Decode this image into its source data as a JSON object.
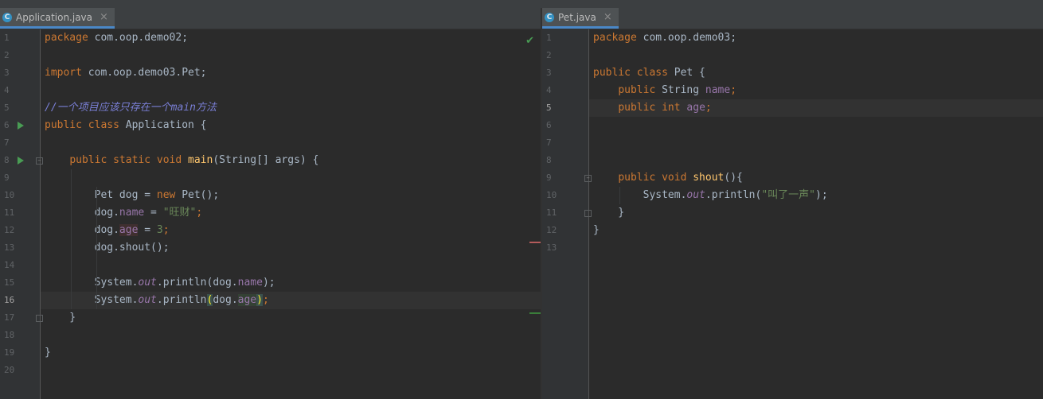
{
  "colors": {
    "keyword": "#cc7832",
    "string": "#6a8759",
    "field": "#9876aa",
    "method": "#ffc66d",
    "comment": "#7a7fd6",
    "default_text": "#a9b7c6",
    "run_icon": "#499c54",
    "tab_accent": "#4a88c7"
  },
  "left": {
    "tab": {
      "icon": "C",
      "icon_name": "class-icon",
      "label": "Application.java",
      "close": "×"
    },
    "status_icon": "✔",
    "current_line": 16,
    "line_numbers": [
      "1",
      "2",
      "3",
      "4",
      "5",
      "6",
      "7",
      "8",
      "9",
      "10",
      "11",
      "12",
      "13",
      "14",
      "15",
      "16",
      "17",
      "18",
      "19",
      "20"
    ],
    "lines": [
      [
        [
          "kw",
          "package"
        ],
        [
          "plain",
          " com.oop.demo02;"
        ]
      ],
      [],
      [
        [
          "kw",
          "import"
        ],
        [
          "plain",
          " com.oop.demo03.Pet;"
        ]
      ],
      [],
      [
        [
          "cmt",
          "//一个项目应该只存在一个main方法"
        ]
      ],
      [
        [
          "kw",
          "public class"
        ],
        [
          "plain",
          " Application {"
        ]
      ],
      [],
      [
        [
          "plain",
          "    "
        ],
        [
          "kw",
          "public static void"
        ],
        [
          "plain",
          " "
        ],
        [
          "method",
          "main"
        ],
        [
          "plain",
          "(String[] args) {"
        ]
      ],
      [],
      [
        [
          "plain",
          "        Pet dog = "
        ],
        [
          "kw",
          "new"
        ],
        [
          "plain",
          " Pet();"
        ]
      ],
      [
        [
          "plain",
          "        dog."
        ],
        [
          "field",
          "name"
        ],
        [
          "plain",
          " = "
        ],
        [
          "str",
          "\"旺财\""
        ],
        [
          "kw",
          ";"
        ]
      ],
      [
        [
          "plain",
          "        dog."
        ],
        [
          "field field-unused",
          "age"
        ],
        [
          "plain",
          " = "
        ],
        [
          "str",
          "3"
        ],
        [
          "kw",
          ";"
        ]
      ],
      [
        [
          "plain",
          "        dog.shout();"
        ]
      ],
      [],
      [
        [
          "plain",
          "        System."
        ],
        [
          "static-field",
          "out"
        ],
        [
          "plain",
          ".println(dog."
        ],
        [
          "field",
          "name"
        ],
        [
          "plain",
          ");"
        ]
      ],
      [
        [
          "plain",
          "        System."
        ],
        [
          "static-field",
          "out"
        ],
        [
          "plain",
          ".println"
        ],
        [
          "brace-hl",
          "("
        ],
        [
          "plain",
          "dog."
        ],
        [
          "field field-hl",
          "age"
        ],
        [
          "brace-hl",
          ")"
        ],
        [
          "kw",
          ";"
        ]
      ],
      [
        [
          "plain",
          "    }"
        ]
      ],
      [],
      [
        [
          "plain",
          "}"
        ]
      ],
      []
    ]
  },
  "right": {
    "tab": {
      "icon": "C",
      "icon_name": "class-icon",
      "label": "Pet.java",
      "close": "×"
    },
    "current_line": 5,
    "line_numbers": [
      "1",
      "2",
      "3",
      "4",
      "5",
      "6",
      "7",
      "8",
      "9",
      "10",
      "11",
      "12",
      "13"
    ],
    "lines": [
      [
        [
          "kw",
          "package"
        ],
        [
          "plain",
          " com.oop.demo03;"
        ]
      ],
      [],
      [
        [
          "kw",
          "public class"
        ],
        [
          "plain",
          " Pet {"
        ]
      ],
      [
        [
          "plain",
          "    "
        ],
        [
          "kw",
          "public"
        ],
        [
          "plain",
          " String "
        ],
        [
          "field",
          "name"
        ],
        [
          "kw",
          ";"
        ]
      ],
      [
        [
          "plain",
          "    "
        ],
        [
          "kw",
          "public int"
        ],
        [
          "plain",
          " "
        ],
        [
          "field",
          "age"
        ],
        [
          "kw",
          ";"
        ]
      ],
      [],
      [],
      [],
      [
        [
          "plain",
          "    "
        ],
        [
          "kw",
          "public void"
        ],
        [
          "plain",
          " "
        ],
        [
          "method",
          "shout"
        ],
        [
          "plain",
          "(){"
        ]
      ],
      [
        [
          "plain",
          "        System."
        ],
        [
          "static-field",
          "out"
        ],
        [
          "plain",
          ".println("
        ],
        [
          "str",
          "\"叫了一声\""
        ],
        [
          "plain",
          ");"
        ]
      ],
      [
        [
          "plain",
          "    }"
        ]
      ],
      [
        [
          "plain",
          "}"
        ]
      ],
      []
    ]
  }
}
